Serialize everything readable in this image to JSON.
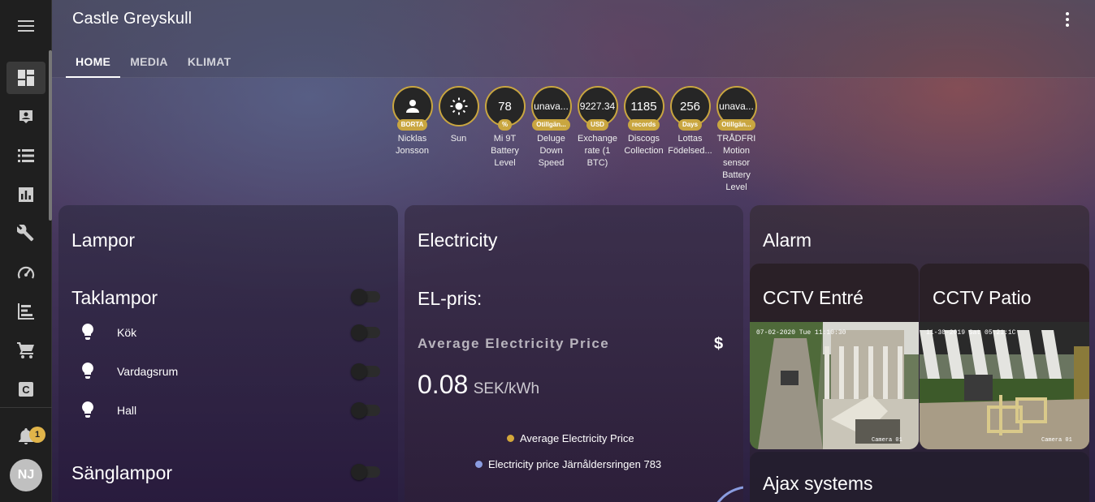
{
  "app": {
    "title": "Castle Greyskull"
  },
  "tabs": [
    {
      "label": "HOME"
    },
    {
      "label": "MEDIA"
    },
    {
      "label": "KLIMAT"
    }
  ],
  "sidebar": {
    "items": [
      {
        "icon": "dashboard-icon"
      },
      {
        "icon": "account-box-icon"
      },
      {
        "icon": "list-icon"
      },
      {
        "icon": "chart-icon"
      },
      {
        "icon": "wrench-icon"
      },
      {
        "icon": "gauge-icon"
      },
      {
        "icon": "timeline-icon"
      },
      {
        "icon": "cart-icon"
      },
      {
        "icon": "c-box-icon"
      }
    ],
    "notifications_count": "1",
    "user_initials": "NJ"
  },
  "badges": [
    {
      "value": "",
      "unit": "BORTA",
      "name": "Nicklas Jonsson"
    },
    {
      "value": "",
      "unit": "",
      "name": "Sun"
    },
    {
      "value": "78",
      "unit": "%",
      "name": "Mi 9T Battery Level"
    },
    {
      "value": "unava...",
      "unit": "Otillgän...",
      "name": "Deluge Down Speed"
    },
    {
      "value": "9227.34",
      "unit": "USD",
      "name": "Exchange rate (1 BTC)"
    },
    {
      "value": "1185",
      "unit": "records",
      "name": "Discogs Collection"
    },
    {
      "value": "256",
      "unit": "Days",
      "name": "Lottas Födelsed..."
    },
    {
      "value": "unava...",
      "unit": "Otillgän...",
      "name": "TRÅDFRI Motion sensor Battery Level"
    }
  ],
  "lampor": {
    "title": "Lampor",
    "group1": "Taklampor",
    "items": [
      "Kök",
      "Vardagsrum",
      "Hall"
    ],
    "group2": "Sänglampor"
  },
  "electricity": {
    "title": "Electricity",
    "subtitle": "EL-pris:",
    "sensor_name": "Average Electricity Price",
    "currency_icon": "$",
    "value": "0.08",
    "unit": "SEK/kWh",
    "legend": [
      {
        "name": "Average Electricity Price",
        "color": "#d4a73a"
      },
      {
        "name": "Electricity price Järnåldersringen 783",
        "color": "#8a9ce0"
      }
    ]
  },
  "alarm": {
    "title": "Alarm",
    "cam1": {
      "title": "CCTV Entré",
      "timestamp": "07-02-2020 Tue 11:10:30",
      "label": "Camera 01"
    },
    "cam2": {
      "title": "CCTV Patio",
      "timestamp": "11-30-2019 Sat 05:21:1C",
      "label": "Camera 01"
    },
    "ajax": "Ajax systems"
  },
  "colors": {
    "accent": "#c9a640",
    "sidebar": "#1f1f1f"
  }
}
